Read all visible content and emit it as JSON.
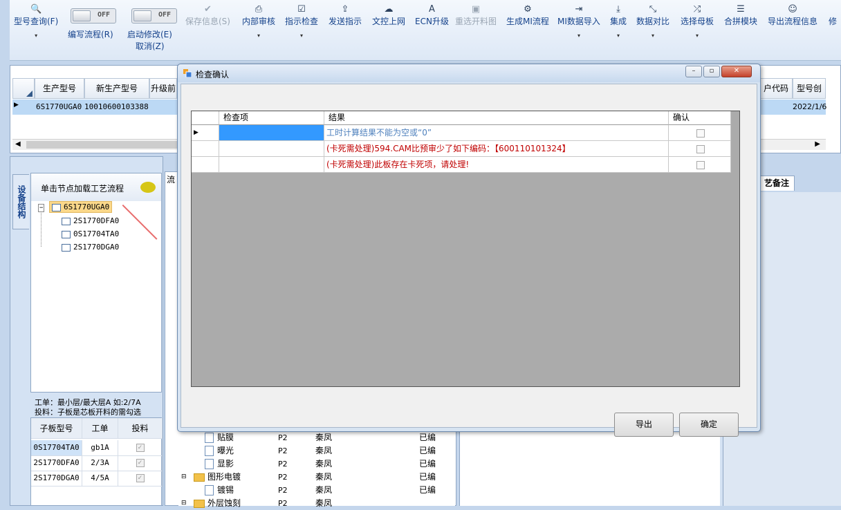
{
  "toolbar": {
    "items": [
      {
        "label": "型号查询(F)",
        "icon": "search-icon",
        "dropdown": true
      },
      {
        "label": "保存信息(S)",
        "icon": "check-icon",
        "disabled": true
      },
      {
        "label": "内部审核",
        "icon": "print-icon",
        "dropdown": true
      },
      {
        "label": "指示检查",
        "icon": "checkbox-icon",
        "dropdown": true
      },
      {
        "label": "发送指示",
        "icon": "upload-icon"
      },
      {
        "label": "文控上网",
        "icon": "cloud-upload-icon"
      },
      {
        "label": "ECN升级",
        "icon": "font-icon"
      },
      {
        "label": "重选开料图",
        "icon": "image-icon",
        "disabled": true
      },
      {
        "label": "生成MI流程",
        "icon": "gears-icon"
      },
      {
        "label": "MI数据导入",
        "icon": "sign-in-icon",
        "dropdown": true
      },
      {
        "label": "集成",
        "icon": "download-icon",
        "dropdown": true
      },
      {
        "label": "数据对比",
        "icon": "compress-icon",
        "dropdown": true
      },
      {
        "label": "选择母板",
        "icon": "random-icon",
        "dropdown": true
      },
      {
        "label": "合拼模块",
        "icon": "list-icon"
      },
      {
        "label": "导出流程信息",
        "icon": "smile-icon"
      },
      {
        "label": "修",
        "icon": ""
      }
    ],
    "toggle1": {
      "state": "OFF",
      "label": "编写流程(R)"
    },
    "toggle2": {
      "state": "OFF",
      "label": "启动修改(E)",
      "label2": "取消(Z)"
    }
  },
  "top_grid": {
    "headers": [
      "生产型号",
      "新生产型号",
      "升级前",
      "户代码",
      "型号创"
    ],
    "row": {
      "prod_model": "6S1770UGA0",
      "new_model": "10010600103388",
      "date": "2022/1/6"
    }
  },
  "left_panel": {
    "vtab": "设备结构",
    "tree_header": "单击节点加载工艺流程",
    "tree": {
      "root": "6S1770UGA0",
      "children": [
        "2S1770DFA0",
        "0S17704TA0",
        "2S1770DGA0"
      ]
    },
    "note1": "工单：最小层/最大层A 如:2/7A",
    "note2": "投料：子板是芯板开料的需勾选",
    "sub_grid": {
      "headers": [
        "子板型号",
        "工单",
        "投料"
      ],
      "rows": [
        {
          "model": "0S17704TA0",
          "order": "gb1A",
          "checked": true
        },
        {
          "model": "2S1770DFA0",
          "order": "2/3A",
          "checked": true
        },
        {
          "model": "2S1770DGA0",
          "order": "4/5A",
          "checked": true
        }
      ]
    }
  },
  "mid_panel": {
    "tab": "流",
    "rows": [
      {
        "name": "贴膜",
        "p": "P2",
        "who": "秦凤",
        "status": "已编"
      },
      {
        "name": "曝光",
        "p": "P2",
        "who": "秦凤",
        "status": "已编"
      },
      {
        "name": "显影",
        "p": "P2",
        "who": "秦凤",
        "status": "已编"
      },
      {
        "name": "图形电镀",
        "p": "P2",
        "who": "秦凤",
        "status": "已编",
        "folder": true
      },
      {
        "name": "镀锡",
        "p": "P2",
        "who": "秦凤",
        "status": "已编"
      },
      {
        "name": "外层蚀刻",
        "p": "P2",
        "who": "秦凤",
        "status": "",
        "folder": true
      }
    ]
  },
  "right_panel": {
    "tab": "艺备注"
  },
  "dialog": {
    "title": "检查确认",
    "grid_headers": [
      "检查项",
      "结果",
      "确认"
    ],
    "rows": [
      {
        "item": "",
        "result": "工时计算结果不能为空或“0”",
        "confirmed": false,
        "color": "blue"
      },
      {
        "item": "",
        "result": "(卡死需处理)594.CAM比预审少了如下编码：【600110101324】",
        "confirmed": false,
        "color": "red"
      },
      {
        "item": "",
        "result": "(卡死需处理)此板存在卡死项，请处理!",
        "confirmed": false,
        "color": "red"
      }
    ],
    "export_label": "导出",
    "ok_label": "确定"
  }
}
